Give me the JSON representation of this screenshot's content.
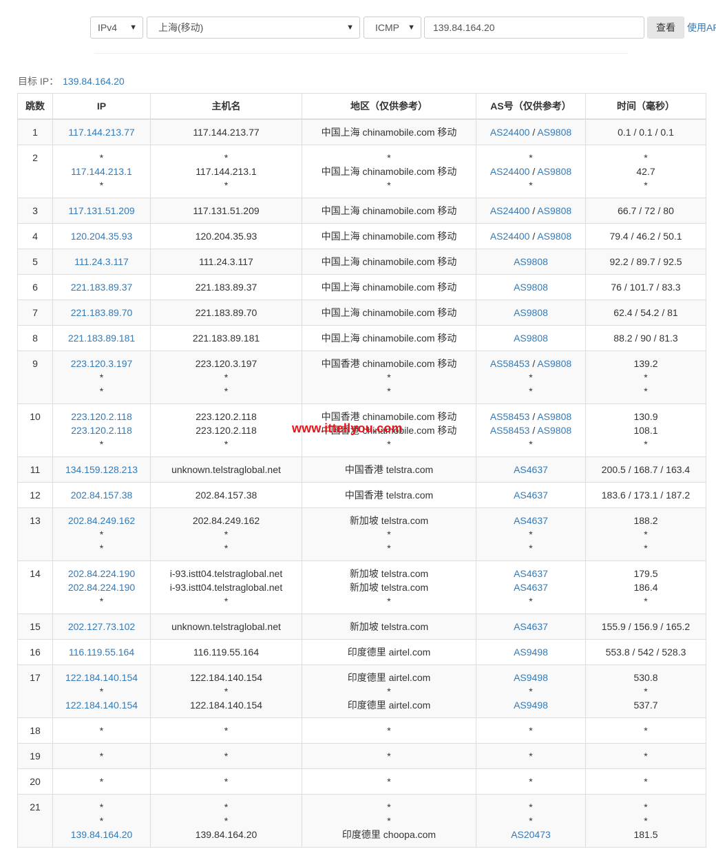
{
  "toolbar": {
    "protocol_version": "IPv4",
    "node": "上海(移动)",
    "method": "ICMP",
    "target_input": "139.84.164.20",
    "query_button": "查看",
    "api_link": "使用API"
  },
  "target": {
    "label": "目标 IP：",
    "ip": "139.84.164.20"
  },
  "table": {
    "headers": [
      "跳数",
      "IP",
      "主机名",
      "地区（仅供参考）",
      "AS号（仅供参考）",
      "时间（毫秒）"
    ],
    "rows": [
      {
        "hop": "1",
        "ip": [
          "117.144.213.77"
        ],
        "host": [
          "117.144.213.77"
        ],
        "region": [
          "中国上海 chinamobile.com 移动"
        ],
        "as": [
          [
            "AS24400",
            "AS9808"
          ]
        ],
        "time": [
          "0.1 / 0.1 / 0.1"
        ]
      },
      {
        "hop": "2",
        "ip": [
          "*",
          "117.144.213.1",
          "*"
        ],
        "host": [
          "*",
          "117.144.213.1",
          "*"
        ],
        "region": [
          "*",
          "中国上海 chinamobile.com 移动",
          "*"
        ],
        "as": [
          [
            "*"
          ],
          [
            "AS24400",
            "AS9808"
          ],
          [
            "*"
          ]
        ],
        "time": [
          "*",
          "42.7",
          "*"
        ]
      },
      {
        "hop": "3",
        "ip": [
          "117.131.51.209"
        ],
        "host": [
          "117.131.51.209"
        ],
        "region": [
          "中国上海 chinamobile.com 移动"
        ],
        "as": [
          [
            "AS24400",
            "AS9808"
          ]
        ],
        "time": [
          "66.7 / 72 / 80"
        ]
      },
      {
        "hop": "4",
        "ip": [
          "120.204.35.93"
        ],
        "host": [
          "120.204.35.93"
        ],
        "region": [
          "中国上海 chinamobile.com 移动"
        ],
        "as": [
          [
            "AS24400",
            "AS9808"
          ]
        ],
        "time": [
          "79.4 / 46.2 / 50.1"
        ]
      },
      {
        "hop": "5",
        "ip": [
          "111.24.3.117"
        ],
        "host": [
          "111.24.3.117"
        ],
        "region": [
          "中国上海 chinamobile.com 移动"
        ],
        "as": [
          [
            "AS9808"
          ]
        ],
        "time": [
          "92.2 / 89.7 / 92.5"
        ]
      },
      {
        "hop": "6",
        "ip": [
          "221.183.89.37"
        ],
        "host": [
          "221.183.89.37"
        ],
        "region": [
          "中国上海 chinamobile.com 移动"
        ],
        "as": [
          [
            "AS9808"
          ]
        ],
        "time": [
          "76 / 101.7 / 83.3"
        ]
      },
      {
        "hop": "7",
        "ip": [
          "221.183.89.70"
        ],
        "host": [
          "221.183.89.70"
        ],
        "region": [
          "中国上海 chinamobile.com 移动"
        ],
        "as": [
          [
            "AS9808"
          ]
        ],
        "time": [
          "62.4 / 54.2 / 81"
        ]
      },
      {
        "hop": "8",
        "ip": [
          "221.183.89.181"
        ],
        "host": [
          "221.183.89.181"
        ],
        "region": [
          "中国上海 chinamobile.com 移动"
        ],
        "as": [
          [
            "AS9808"
          ]
        ],
        "time": [
          "88.2 / 90 / 81.3"
        ]
      },
      {
        "hop": "9",
        "ip": [
          "223.120.3.197",
          "*",
          "*"
        ],
        "host": [
          "223.120.3.197",
          "*",
          "*"
        ],
        "region": [
          "中国香港 chinamobile.com 移动",
          "*",
          "*"
        ],
        "as": [
          [
            "AS58453",
            "AS9808"
          ],
          [
            "*"
          ],
          [
            "*"
          ]
        ],
        "time": [
          "139.2",
          "*",
          "*"
        ]
      },
      {
        "hop": "10",
        "ip": [
          "223.120.2.118",
          "223.120.2.118",
          "*"
        ],
        "host": [
          "223.120.2.118",
          "223.120.2.118",
          "*"
        ],
        "region": [
          "中国香港 chinamobile.com 移动",
          "中国香港 chinamobile.com 移动",
          "*"
        ],
        "as": [
          [
            "AS58453",
            "AS9808"
          ],
          [
            "AS58453",
            "AS9808"
          ],
          [
            "*"
          ]
        ],
        "time": [
          "130.9",
          "108.1",
          "*"
        ]
      },
      {
        "hop": "11",
        "ip": [
          "134.159.128.213"
        ],
        "host": [
          "unknown.telstraglobal.net"
        ],
        "region": [
          "中国香港 telstra.com"
        ],
        "as": [
          [
            "AS4637"
          ]
        ],
        "time": [
          "200.5 / 168.7 / 163.4"
        ]
      },
      {
        "hop": "12",
        "ip": [
          "202.84.157.38"
        ],
        "host": [
          "202.84.157.38"
        ],
        "region": [
          "中国香港 telstra.com"
        ],
        "as": [
          [
            "AS4637"
          ]
        ],
        "time": [
          "183.6 / 173.1 / 187.2"
        ]
      },
      {
        "hop": "13",
        "ip": [
          "202.84.249.162",
          "*",
          "*"
        ],
        "host": [
          "202.84.249.162",
          "*",
          "*"
        ],
        "region": [
          "新加坡 telstra.com",
          "*",
          "*"
        ],
        "as": [
          [
            "AS4637"
          ],
          [
            "*"
          ],
          [
            "*"
          ]
        ],
        "time": [
          "188.2",
          "*",
          "*"
        ]
      },
      {
        "hop": "14",
        "ip": [
          "202.84.224.190",
          "202.84.224.190",
          "*"
        ],
        "host": [
          "i-93.istt04.telstraglobal.net",
          "i-93.istt04.telstraglobal.net",
          "*"
        ],
        "region": [
          "新加坡 telstra.com",
          "新加坡 telstra.com",
          "*"
        ],
        "as": [
          [
            "AS4637"
          ],
          [
            "AS4637"
          ],
          [
            "*"
          ]
        ],
        "time": [
          "179.5",
          "186.4",
          "*"
        ]
      },
      {
        "hop": "15",
        "ip": [
          "202.127.73.102"
        ],
        "host": [
          "unknown.telstraglobal.net"
        ],
        "region": [
          "新加坡 telstra.com"
        ],
        "as": [
          [
            "AS4637"
          ]
        ],
        "time": [
          "155.9 / 156.9 / 165.2"
        ]
      },
      {
        "hop": "16",
        "ip": [
          "116.119.55.164"
        ],
        "host": [
          "116.119.55.164"
        ],
        "region": [
          "印度德里 airtel.com"
        ],
        "as": [
          [
            "AS9498"
          ]
        ],
        "time": [
          "553.8 / 542 / 528.3"
        ]
      },
      {
        "hop": "17",
        "ip": [
          "122.184.140.154",
          "*",
          "122.184.140.154"
        ],
        "host": [
          "122.184.140.154",
          "*",
          "122.184.140.154"
        ],
        "region": [
          "印度德里 airtel.com",
          "*",
          "印度德里 airtel.com"
        ],
        "as": [
          [
            "AS9498"
          ],
          [
            "*"
          ],
          [
            "AS9498"
          ]
        ],
        "time": [
          "530.8",
          "*",
          "537.7"
        ]
      },
      {
        "hop": "18",
        "ip": [
          "*"
        ],
        "host": [
          "*"
        ],
        "region": [
          "*"
        ],
        "as": [
          [
            "*"
          ]
        ],
        "time": [
          "*"
        ]
      },
      {
        "hop": "19",
        "ip": [
          "*"
        ],
        "host": [
          "*"
        ],
        "region": [
          "*"
        ],
        "as": [
          [
            "*"
          ]
        ],
        "time": [
          "*"
        ]
      },
      {
        "hop": "20",
        "ip": [
          "*"
        ],
        "host": [
          "*"
        ],
        "region": [
          "*"
        ],
        "as": [
          [
            "*"
          ]
        ],
        "time": [
          "*"
        ]
      },
      {
        "hop": "21",
        "ip": [
          "*",
          "*",
          "139.84.164.20"
        ],
        "host": [
          "*",
          "*",
          "139.84.164.20"
        ],
        "region": [
          "*",
          "*",
          "印度德里 choopa.com"
        ],
        "as": [
          [
            "*"
          ],
          [
            "*"
          ],
          [
            "AS20473"
          ]
        ],
        "time": [
          "*",
          "*",
          "181.5"
        ]
      }
    ]
  },
  "watermark": "www.ittellyou.com"
}
